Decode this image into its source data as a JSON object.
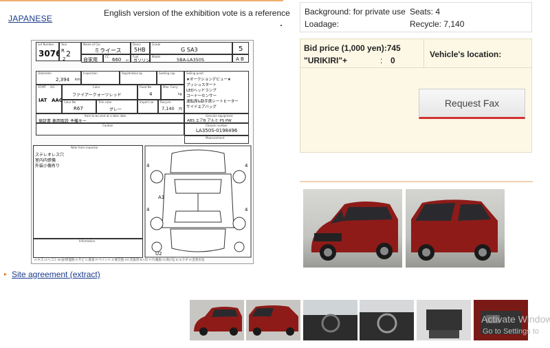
{
  "header": {
    "language_link": "JAPANESE",
    "note": "English version of the exhibition vote is a reference"
  },
  "sheet": {
    "lot_number_label": "Lot Number",
    "lot_number": "3076",
    "year_label": "Year",
    "year_top": "R",
    "year_value": "2",
    "year_sub": "2",
    "name_label": "Name of Car",
    "car_name": "ミライース",
    "doors_label": "Doors",
    "doors": "5HB",
    "grade_label": "Grade",
    "grade": "G SA3",
    "score": "5",
    "use": "自家用",
    "cc_label": "CC",
    "cc": "660",
    "cc_unit": "cc",
    "fuel_label": "Fuel",
    "fuel": "ガソリン",
    "model_label": "Model",
    "model": "5BA-LA350S",
    "interior_grade": "A B",
    "odometer_label": "Odometer",
    "odometer": "2,394",
    "odometer_unit": "km",
    "inspection_label": "Inspection",
    "registration_label": "Registration by",
    "seating_label": "Seating cap",
    "selling_points_label": "Selling point",
    "selling_points": [
      "★オークションデビュー★",
      "プッシュスタート",
      "LEDヘッドランプ",
      "コーナーセンサー",
      "運転席&助手席シートヒーター",
      "サイドエアバッグ"
    ],
    "transmission_label": "AT/MT",
    "ac_label": "A/C",
    "color_label": "Color",
    "transmission": "IAT",
    "ac": "AAC",
    "color": "ファイアークォーツレッド",
    "fixed_no_label": "Fixed No",
    "fixed_no": "4",
    "max_carry_label": "Max. Carry",
    "max_carry_unit": "kg",
    "color_no_label": "Color No",
    "color_no": "R67",
    "trim_color_label": "Trim color",
    "trim_color": "グレー",
    "import_car_label": "Import car",
    "recycle_label": "Recycle",
    "recycle": "7,140",
    "recycle_unit": "円",
    "recycle_note": "サイドエアバッグ",
    "to_sign_label": "Item to be sent at a later date",
    "to_sign": "保証書 車両取説 予備キー",
    "genuine_label": "Genuine equipment",
    "genuine": "ABS エアB アルミ PS PW",
    "caution_label": "Caution",
    "chassis_label": "Chassis number",
    "chassis": "LA350S-0198496",
    "measure_label": "Measurement",
    "inspector_label": "Note from inspector",
    "inspector_notes": [
      "ステレオレス穴",
      "室内内張傷",
      "外装小傷有り"
    ],
    "information_label": "Information",
    "panel_marks": [
      "A1",
      "U2"
    ],
    "footer": "A:キズ U:ヘコミ W:波/修理跡 S:サビ C:腐食 P:ペイント X:要交換 XX:交換済 B:A凹 Y:穴/亀裂 G:飛び石 E:エクボ H:塗装劣化"
  },
  "site_agreement": "Site agreement (extract)",
  "info": {
    "background": "Background: for private use",
    "seats": "Seats: 4",
    "loadage": "Loadage:",
    "recycle": "Recycle: 7,140"
  },
  "bid": {
    "price": "Bid price (1,000 yen):745",
    "urikiri_label": "\"URIKIRI\"+",
    "urikiri_sep": ":",
    "urikiri_value": "0",
    "location": "Vehicle's location:",
    "fax_button": "Request Fax"
  },
  "watermark": {
    "line1": "Activate Windows",
    "line2": "Go to Settings to"
  },
  "colors": {
    "car_red": "#8e1b18",
    "link": "#1a3a8a",
    "bid_bg": "#fdf8e6",
    "fax_underline": "#d03030"
  }
}
